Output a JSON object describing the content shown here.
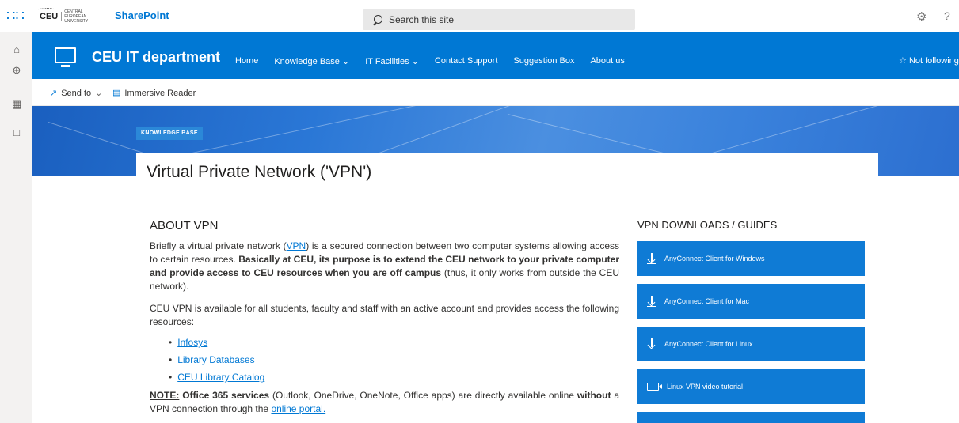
{
  "suite": {
    "logo_abbr": "CEU",
    "logo_name": "CENTRAL EUROPEAN UNIVERSITY",
    "app_name": "SharePoint",
    "search_placeholder": "Search this site"
  },
  "site": {
    "title": "CEU IT department",
    "nav": [
      {
        "label": "Home",
        "has_dropdown": false
      },
      {
        "label": "Knowledge Base",
        "has_dropdown": true
      },
      {
        "label": "IT Facilities",
        "has_dropdown": true
      },
      {
        "label": "Contact Support",
        "has_dropdown": false
      },
      {
        "label": "Suggestion Box",
        "has_dropdown": false
      },
      {
        "label": "About us",
        "has_dropdown": false
      }
    ],
    "follow_label": "Not following"
  },
  "commands": {
    "send_to": "Send to",
    "immersive_reader": "Immersive Reader"
  },
  "page": {
    "tag": "KNOWLEDGE BASE",
    "title": "Virtual Private Network ('VPN')"
  },
  "about": {
    "heading": "ABOUT VPN",
    "p1_a": "Briefly a virtual private network (",
    "p1_link": "VPN",
    "p1_b": ") is a secured connection between two computer systems allowing access to certain resources. ",
    "p1_bold": "Basically at CEU, its purpose is to extend the CEU network to your private computer and provide access to CEU resources when you are off campus",
    "p1_c": " (thus, it only works from outside the CEU network).",
    "p2": "CEU VPN is available for all students, faculty and staff with an active account and provides access the following resources:",
    "resources": [
      "Infosys",
      "Library Databases",
      "CEU Library Catalog"
    ],
    "note_label": "NOTE:",
    "note_bold1": "Office 365 services",
    "note_a": " (Outlook, OneDrive, OneNote, Office apps) are directly available online ",
    "note_bold2": "without",
    "note_b": " a VPN connection through the ",
    "note_link": "online portal."
  },
  "downloads": {
    "heading": "VPN DOWNLOADS / GUIDES",
    "items": [
      {
        "label": "AnyConnect Client for Windows",
        "icon": "download-icon"
      },
      {
        "label": "AnyConnect Client for Mac",
        "icon": "download-icon"
      },
      {
        "label": "AnyConnect Client for Linux",
        "icon": "download-icon"
      },
      {
        "label": "Linux VPN video tutorial",
        "icon": "video-icon"
      }
    ]
  },
  "colors": {
    "brand_blue": "#0078d4",
    "button_blue": "#0f7bd5"
  }
}
